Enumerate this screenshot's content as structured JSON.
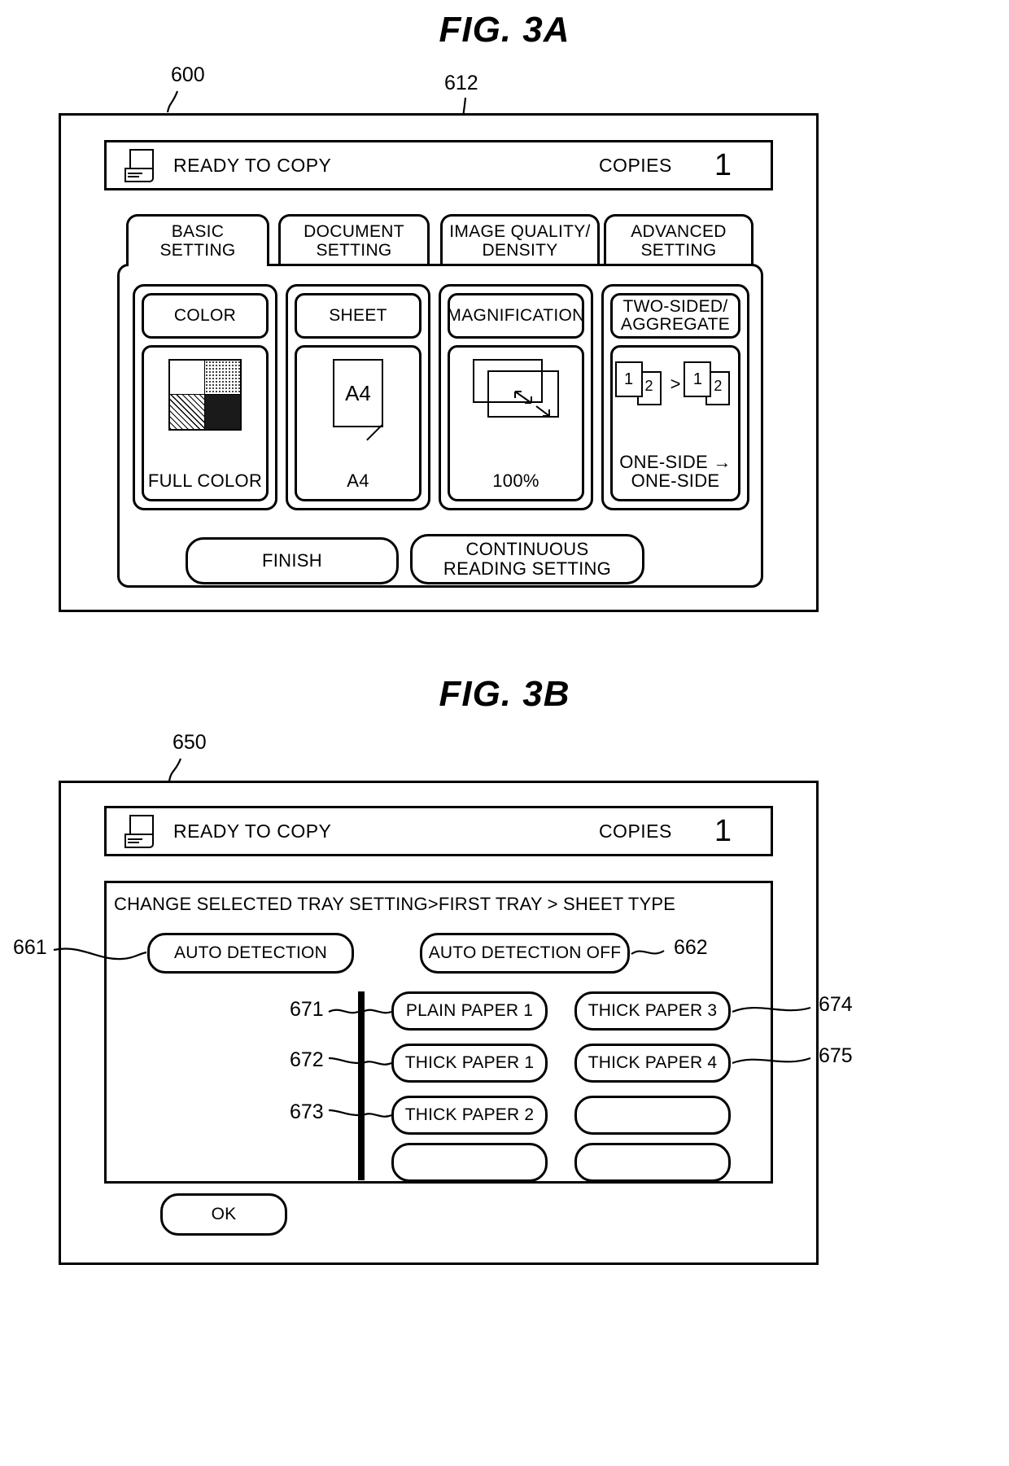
{
  "figures": [
    {
      "title": "FIG. 3A",
      "ref": "600",
      "callout": "612",
      "status": {
        "icon": "printer-icon",
        "message": "READY TO COPY",
        "copies_label": "COPIES",
        "copies_value": "1"
      },
      "tabs": [
        {
          "label": "BASIC\nSETTING",
          "line1": "BASIC",
          "line2": "SETTING",
          "active": true
        },
        {
          "label": "DOCUMENT\nSETTING",
          "line1": "DOCUMENT",
          "line2": "SETTING",
          "active": false
        },
        {
          "label": "IMAGE QUALITY/\nDENSITY",
          "line1": "IMAGE QUALITY/",
          "line2": "DENSITY",
          "active": false
        },
        {
          "label": "ADVANCED\nSETTING",
          "line1": "ADVANCED",
          "line2": "SETTING",
          "active": false
        }
      ],
      "cards": [
        {
          "head": "COLOR",
          "head_line2": "",
          "icon": "color-quadrant-icon",
          "value": "FULL COLOR",
          "value_line2": ""
        },
        {
          "head": "SHEET",
          "head_line2": "",
          "icon": "a4-sheet-icon",
          "icon_text": "A4",
          "value": "A4",
          "value_line2": ""
        },
        {
          "head": "MAGNIFICATION",
          "head_line2": "",
          "icon": "magnification-icon",
          "value": "100%",
          "value_line2": ""
        },
        {
          "head": "TWO-SIDED/",
          "head_line2": "AGGREGATE",
          "icon": "two-sided-icon",
          "icon_left_1": "1",
          "icon_left_2": "2",
          "icon_sep": ">",
          "icon_right_1": "1",
          "icon_right_2": "2",
          "value": "ONE-SIDE →",
          "value_line2": "ONE-SIDE"
        }
      ],
      "bottom_buttons": [
        {
          "line1": "FINISH",
          "line2": ""
        },
        {
          "line1": "CONTINUOUS",
          "line2": "READING SETTING"
        }
      ]
    },
    {
      "title": "FIG. 3B",
      "ref": "650",
      "status": {
        "icon": "printer-icon",
        "message": "READY TO COPY",
        "copies_label": "COPIES",
        "copies_value": "1"
      },
      "breadcrumb": "CHANGE SELECTED TRAY SETTING>FIRST TRAY > SHEET TYPE",
      "detection_buttons": [
        {
          "label": "AUTO DETECTION",
          "ref": "661"
        },
        {
          "label": "AUTO DETECTION OFF",
          "ref": "662"
        }
      ],
      "paper_buttons": [
        {
          "label": "PLAIN PAPER 1",
          "ref": "671"
        },
        {
          "label": "THICK PAPER 1",
          "ref": "672"
        },
        {
          "label": "THICK PAPER 2",
          "ref": "673"
        },
        {
          "label": "",
          "ref": ""
        },
        {
          "label": "THICK PAPER 3",
          "ref": "674"
        },
        {
          "label": "THICK PAPER 4",
          "ref": "675"
        },
        {
          "label": "",
          "ref": ""
        },
        {
          "label": "",
          "ref": ""
        }
      ],
      "ok_button": "OK"
    }
  ]
}
